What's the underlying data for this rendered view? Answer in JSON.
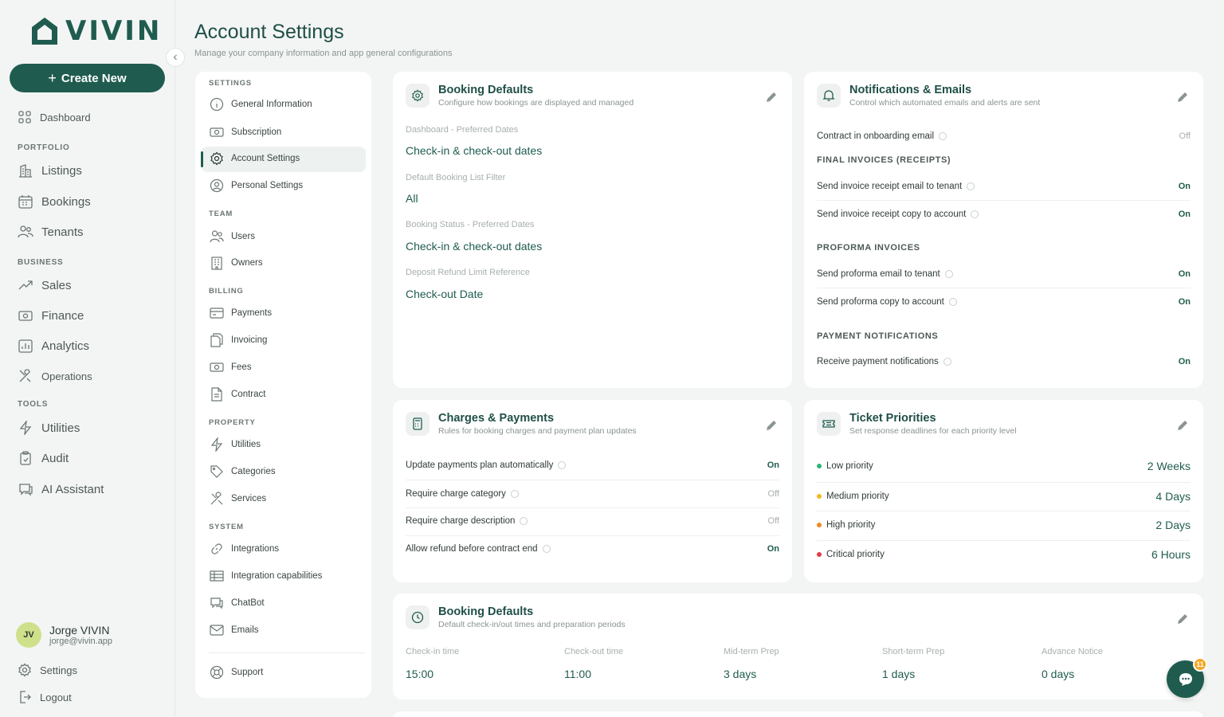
{
  "app": {
    "logo_text": "VIVIN",
    "brand_color": "#1f5c4f"
  },
  "sidebar": {
    "create_label": "Create New",
    "dashboard": "Dashboard",
    "sections": {
      "portfolio": "PORTFOLIO",
      "business": "BUSINESS",
      "tools": "TOOLS"
    },
    "items": {
      "listings": "Listings",
      "bookings": "Bookings",
      "tenants": "Tenants",
      "sales": "Sales",
      "finance": "Finance",
      "analytics": "Analytics",
      "operations": "Operations",
      "utilities": "Utilities",
      "audit": "Audit",
      "ai": "AI Assistant"
    },
    "user": {
      "initials": "JV",
      "name": "Jorge VIVIN",
      "email": "jorge@vivin.app"
    },
    "settings": "Settings",
    "logout": "Logout"
  },
  "header": {
    "title": "Account Settings",
    "subtitle": "Manage your company information and app general configurations"
  },
  "subnav": {
    "sections": {
      "settings": "SETTINGS",
      "team": "TEAM",
      "billing": "BILLING",
      "property": "PROPERTY",
      "system": "SYSTEM"
    },
    "items": {
      "general": "General Information",
      "subscription": "Subscription",
      "account": "Account Settings",
      "personal": "Personal Settings",
      "users": "Users",
      "owners": "Owners",
      "payments": "Payments",
      "invoicing": "Invoicing",
      "fees": "Fees",
      "contract": "Contract",
      "utilities": "Utilities",
      "categories": "Categories",
      "services": "Services",
      "integrations": "Integrations",
      "capabilities": "Integration capabilities",
      "chatbot": "ChatBot",
      "emails": "Emails",
      "support": "Support"
    },
    "active": "Account Settings"
  },
  "booking_defaults": {
    "title": "Booking Defaults",
    "subtitle": "Configure how bookings are displayed and managed",
    "fields": [
      {
        "label": "Dashboard - Preferred Dates",
        "value": "Check-in & check-out dates"
      },
      {
        "label": "Default Booking List Filter",
        "value": "All"
      },
      {
        "label": "Booking Status - Preferred Dates",
        "value": "Check-in & check-out dates"
      },
      {
        "label": "Deposit Refund Limit Reference",
        "value": "Check-out Date"
      }
    ]
  },
  "notifications": {
    "title": "Notifications & Emails",
    "subtitle": "Control which automated emails and alerts are sent",
    "contract_label": "Contract in onboarding email",
    "contract_value": "Off",
    "groups": {
      "final": "FINAL INVOICES (RECEIPTS)",
      "proforma": "PROFORMA INVOICES",
      "payment": "PAYMENT NOTIFICATIONS"
    },
    "rows": {
      "receipt_tenant": {
        "label": "Send invoice receipt email to tenant",
        "value": "On"
      },
      "receipt_account": {
        "label": "Send invoice receipt copy to account",
        "value": "On"
      },
      "proforma_tenant": {
        "label": "Send proforma email to tenant",
        "value": "On"
      },
      "proforma_account": {
        "label": "Send proforma copy to account",
        "value": "On"
      },
      "payment": {
        "label": "Receive payment notifications",
        "value": "On"
      }
    }
  },
  "charges": {
    "title": "Charges & Payments",
    "subtitle": "Rules for booking charges and payment plan updates",
    "rows": [
      {
        "label": "Update payments plan automatically",
        "value": "On"
      },
      {
        "label": "Require charge category",
        "value": "Off"
      },
      {
        "label": "Require charge description",
        "value": "Off"
      },
      {
        "label": "Allow refund before contract end",
        "value": "On"
      }
    ]
  },
  "tickets": {
    "title": "Ticket Priorities",
    "subtitle": "Set response deadlines for each priority level",
    "rows": [
      {
        "label": "Low priority",
        "value": "2 Weeks",
        "color": "#2fb37a"
      },
      {
        "label": "Medium priority",
        "value": "4 Days",
        "color": "#f5b524"
      },
      {
        "label": "High priority",
        "value": "2 Days",
        "color": "#f08a24"
      },
      {
        "label": "Critical priority",
        "value": "6 Hours",
        "color": "#e53946"
      }
    ]
  },
  "booking_times": {
    "title": "Booking Defaults",
    "subtitle": "Default check-in/out times and preparation periods",
    "cols": [
      {
        "label": "Check-in time",
        "value": "15:00"
      },
      {
        "label": "Check-out time",
        "value": "11:00"
      },
      {
        "label": "Mid-term Prep",
        "value": "3 days"
      },
      {
        "label": "Short-term Prep",
        "value": "1 days"
      },
      {
        "label": "Advance Notice",
        "value": "0 days"
      }
    ]
  },
  "chat": {
    "badge": "11"
  }
}
